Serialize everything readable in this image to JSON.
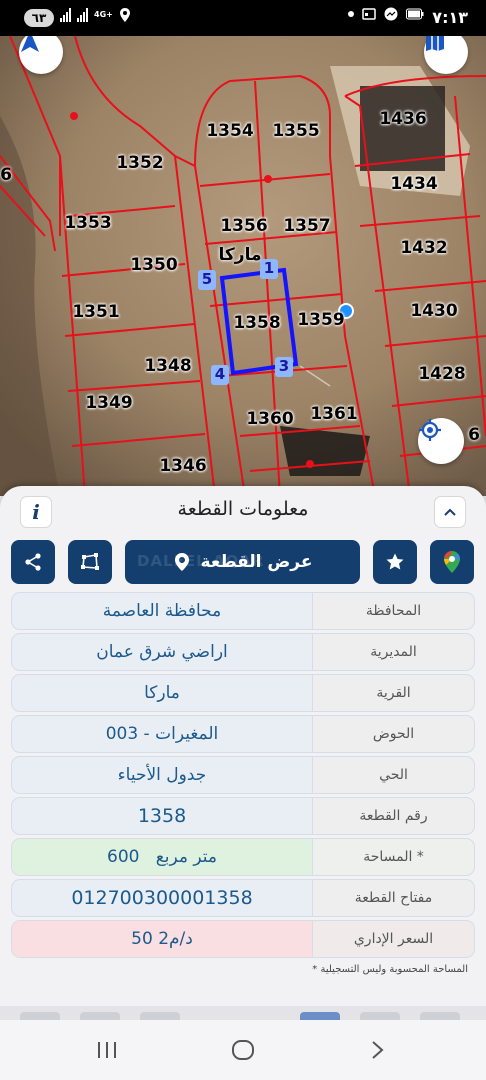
{
  "status_bar": {
    "badge": "٦٣",
    "network": "4G+",
    "time": "٧:١٣"
  },
  "map": {
    "lot_labels": [
      "1354",
      "1355",
      "1436",
      "1352",
      "1434",
      "1353",
      "1356",
      "1357",
      "1432",
      "1350",
      "1351",
      "1358",
      "1359",
      "1430",
      "1348",
      "1428",
      "1349",
      "1360",
      "1361",
      "1346"
    ],
    "edge_labels": [
      "6",
      "6",
      "6"
    ],
    "selected_parcel": "1358",
    "area_name": "ماركا",
    "vertices": [
      "1",
      "3",
      "4",
      "5"
    ],
    "colors": {
      "parcel_lines": "#e8101a",
      "selection": "#1414ff",
      "vertex_bg": "#8fb7ff"
    }
  },
  "panel": {
    "title": "معلومات القطعة",
    "view_button": "عرض القطعة",
    "watermark": "DALEEL AQAR",
    "rows": [
      {
        "label": "المحافظة",
        "value": "محافظة العاصمة"
      },
      {
        "label": "المديرية",
        "value": "اراضي شرق عمان"
      },
      {
        "label": "القرية",
        "value": "ماركا"
      },
      {
        "label": "الحوض",
        "value": "المغيرات - 003"
      },
      {
        "label": "الحي",
        "value": "جدول الأحياء"
      },
      {
        "label": "رقم القطعة",
        "value": "1358"
      },
      {
        "label": "المساحة *",
        "value": "600   متر مربع"
      },
      {
        "label": "مفتاح القطعة",
        "value": "012700300001358"
      },
      {
        "label": "السعر الإداري",
        "value": "50 د/م2"
      }
    ],
    "footnote": "* المساحة المحسوبة وليس التسجيلية"
  },
  "colors": {
    "primary": "#133e6e",
    "value_text": "#1c5a8d",
    "area_bg": "#dff1df",
    "price_bg": "#f9dfe1"
  }
}
